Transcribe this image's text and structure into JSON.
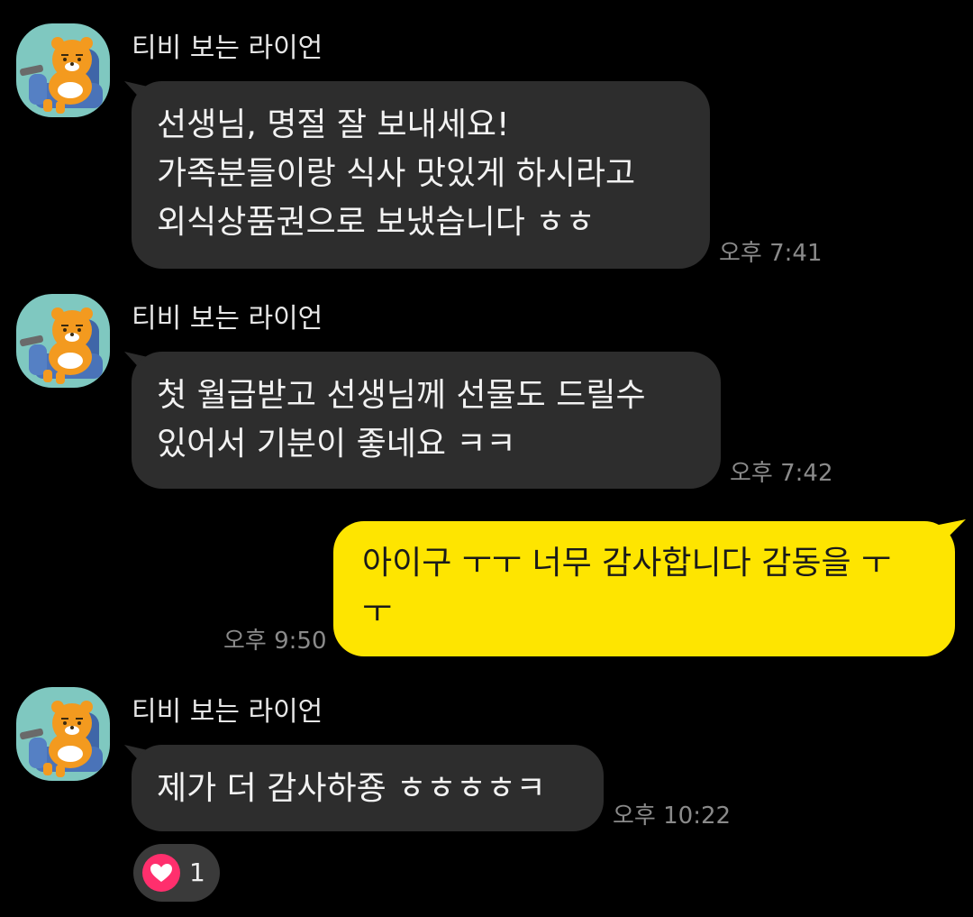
{
  "messages": [
    {
      "sender": "티비 보는 라이언",
      "avatar_icon": "ryan-on-couch-avatar",
      "text": "선생님, 명절 잘 보내세요!\n가족분들이랑 식사 맛있게 하시라고\n외식상품권으로 보냈습니다 ㅎㅎ",
      "time": "오후 7:41"
    },
    {
      "sender": "티비 보는 라이언",
      "avatar_icon": "ryan-on-couch-avatar",
      "text": "첫 월급받고 선생님께 선물도 드릴수\n있어서 기분이 좋네요 ㅋㅋ",
      "time": "오후 7:42"
    },
    {
      "sender": "me",
      "text": "아이구 ㅜㅜ 너무 감사합니다 감동을 ㅜ\nㅜ",
      "time": "오후 9:50"
    },
    {
      "sender": "티비 보는 라이언",
      "avatar_icon": "ryan-on-couch-avatar",
      "text": "제가 더 감사하죵 ㅎㅎㅎㅎㅋ",
      "time": "오후 10:22",
      "reaction": {
        "icon": "heart-icon",
        "count": "1"
      }
    }
  ],
  "colors": {
    "background": "#000000",
    "incoming_bubble": "#2d2d2d",
    "outgoing_bubble": "#fee500",
    "timestamp": "#8a8a8a",
    "reaction_heart": "#ff2f6d"
  }
}
